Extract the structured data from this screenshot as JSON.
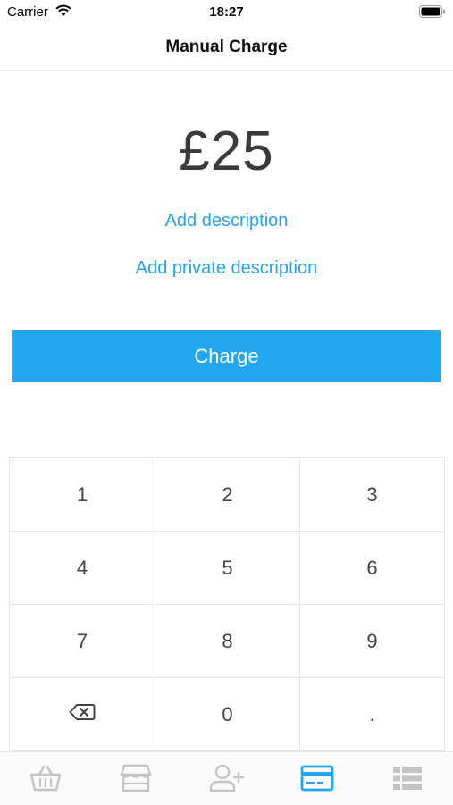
{
  "status_bar": {
    "carrier": "Carrier",
    "time": "18:27"
  },
  "nav": {
    "title": "Manual Charge"
  },
  "amount": "£25",
  "links": {
    "description": "Add description",
    "private_description": "Add private description"
  },
  "charge_button": "Charge",
  "keypad": {
    "k1": "1",
    "k2": "2",
    "k3": "3",
    "k4": "4",
    "k5": "5",
    "k6": "6",
    "k7": "7",
    "k8": "8",
    "k9": "9",
    "k0": "0",
    "kdot": "."
  },
  "tabs": [
    {
      "icon": "basket-icon",
      "active": false
    },
    {
      "icon": "store-icon",
      "active": false
    },
    {
      "icon": "add-user-icon",
      "active": false
    },
    {
      "icon": "card-icon",
      "active": true
    },
    {
      "icon": "list-icon",
      "active": false
    }
  ],
  "colors": {
    "accent": "#21a6ef",
    "link": "#29a3e0",
    "inactive_icon": "#c4c4c4"
  }
}
